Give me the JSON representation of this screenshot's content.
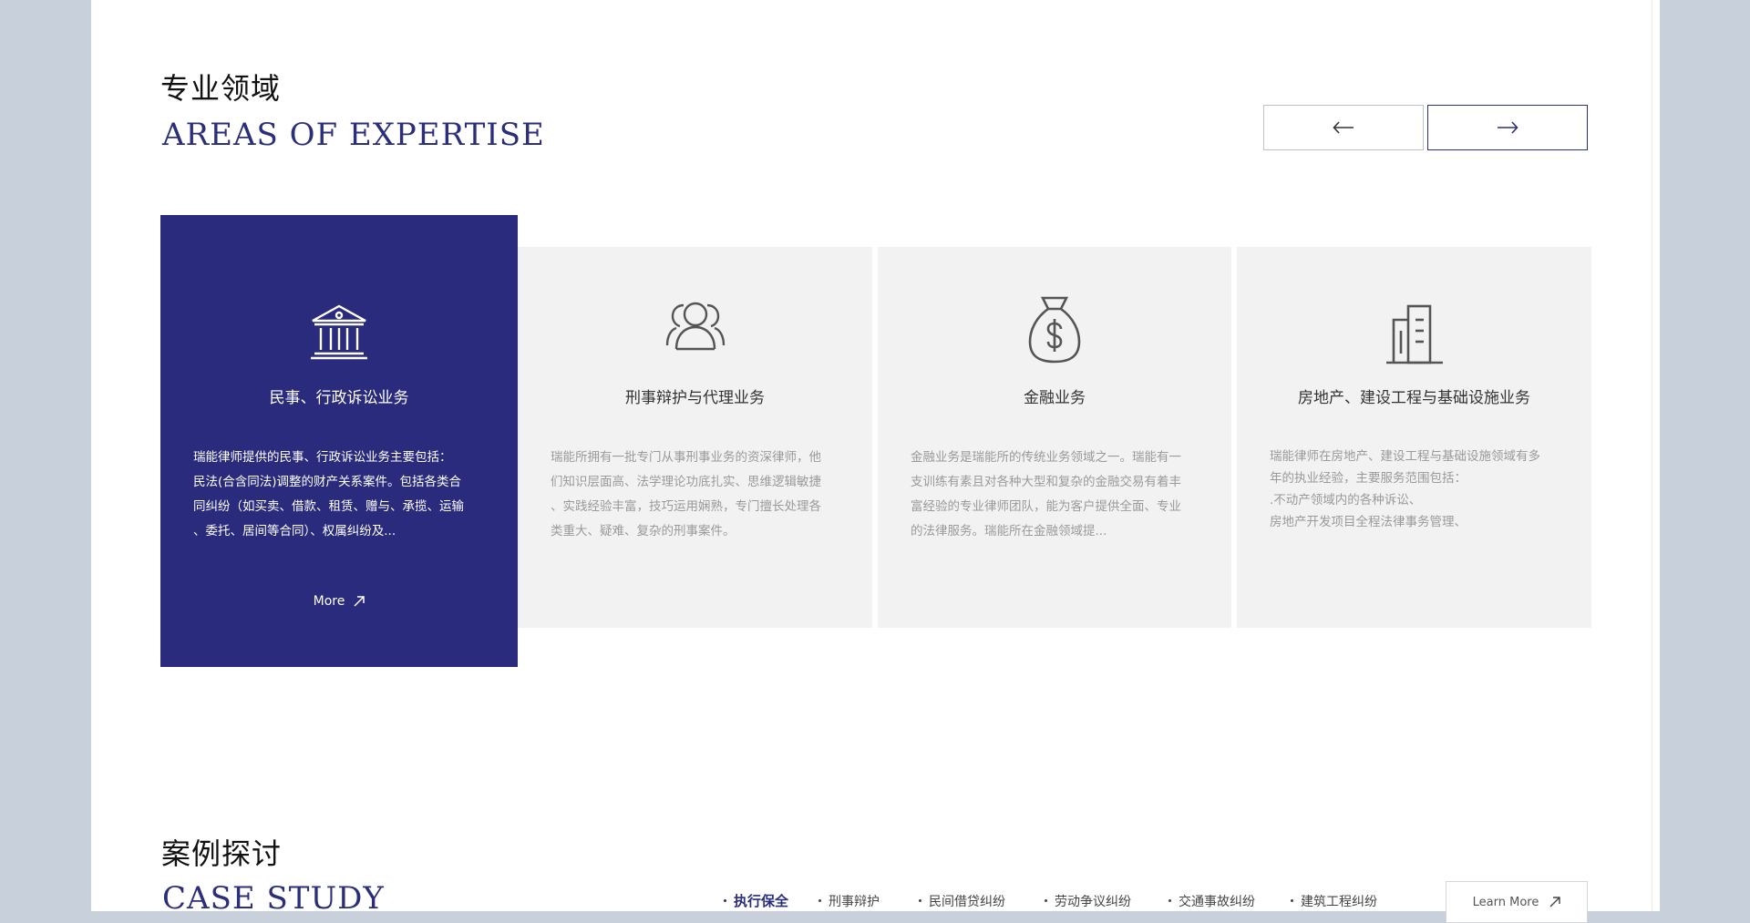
{
  "expertise": {
    "title_cn": "专业领域",
    "title_en": "AREAS OF EXPERTISE",
    "prev_icon": "arrow-left-icon",
    "next_icon": "arrow-right-icon",
    "accent_color": "#2a2b7c",
    "cards": [
      {
        "icon": "courthouse-icon",
        "title": "民事、行政诉讼业务",
        "desc_lines": [
          "瑞能律师提供的民事、行政诉讼业务主要包括：",
          "民法(合含同法)调整的财产关系案件。包括各类合",
          "同纠纷（如买卖、借款、租赁、赠与、承揽、运输",
          "、委托、居间等合同）、权属纠纷及..."
        ],
        "more_label": "More"
      },
      {
        "icon": "users-icon",
        "title": "刑事辩护与代理业务",
        "desc_lines": [
          "瑞能所拥有一批专门从事刑事业务的资深律师，他",
          "们知识层面高、法学理论功底扎实、思维逻辑敏捷",
          "、实践经验丰富，技巧运用娴熟，专门擅长处理各",
          "类重大、疑难、复杂的刑事案件。"
        ]
      },
      {
        "icon": "money-bag-icon",
        "title": "金融业务",
        "desc_lines": [
          "金融业务是瑞能所的传统业务领域之一。瑞能有一",
          "支训练有素且对各种大型和复杂的金融交易有着丰",
          "富经验的专业律师团队，能为客户提供全面、专业",
          "的法律服务。瑞能所在金融领域提..."
        ]
      },
      {
        "icon": "buildings-icon",
        "title": "房地产、建设工程与基础设施业务",
        "desc_lines": [
          "瑞能律师在房地产、建设工程与基础设施领域有多",
          "年的执业经验，主要服务范围包括：",
          ".不动产领域内的各种诉讼、",
          "房地产开发项目全程法律事务管理、"
        ]
      }
    ]
  },
  "case_study": {
    "title_cn": "案例探讨",
    "title_en": "CASE STUDY",
    "tabs": [
      "执行保全",
      "刑事辩护",
      "民间借贷纠纷",
      "劳动争议纠纷",
      "交通事故纠纷",
      "建筑工程纠纷"
    ],
    "active_tab": "执行保全",
    "learn_more_label": "Learn More"
  }
}
